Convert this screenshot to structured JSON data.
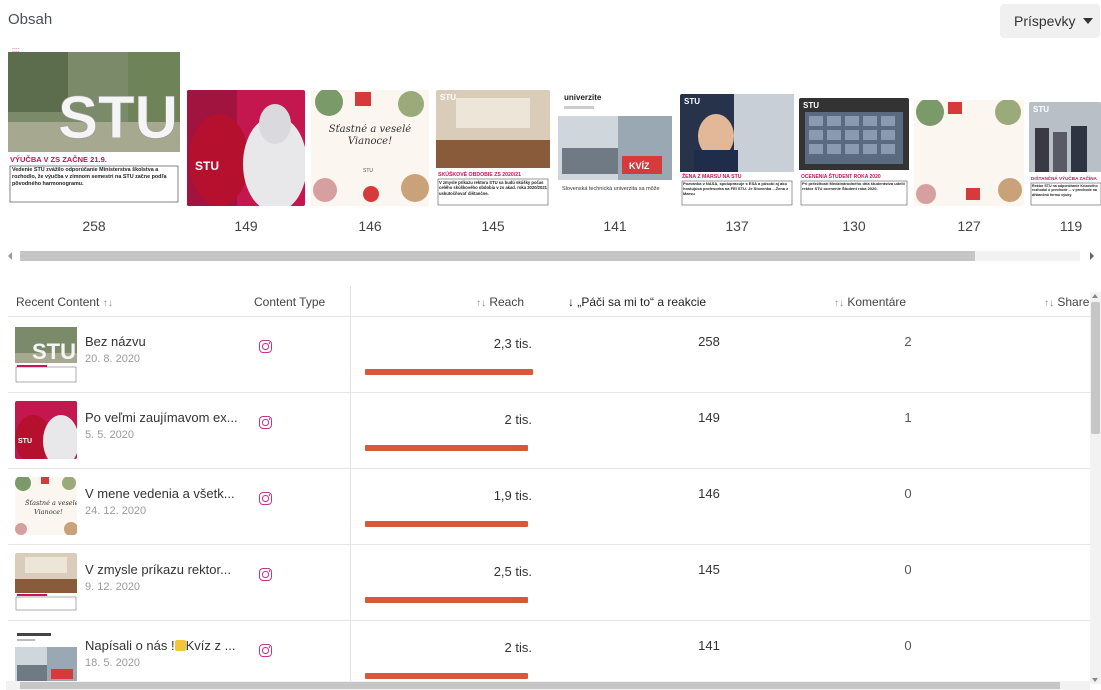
{
  "header": {
    "title": "Obsah",
    "dropdown_label": "Príspevky"
  },
  "colors": {
    "accent_bar": "#d8593a",
    "instagram": "#c0368e"
  },
  "strip": {
    "items": [
      {
        "value": "258",
        "caption": "VÝUČBA V ZS ZAČNE 21.9.",
        "logo": "STU",
        "text": "Vedenie STU zvážilo odporúčanie Ministerstva školstva a rozhodlo, že výučba v zimnom semestri na STU začne podľa pôvodného harmonogramu."
      },
      {
        "value": "149",
        "logo": "STU"
      },
      {
        "value": "146",
        "script": "Šťastné a veselé Vianoce!",
        "logo": "STU"
      },
      {
        "value": "145",
        "caption": "SKÚŠKOVÉ OBDOBIE ZS 2020/21",
        "logo": "STU",
        "text": "V zmysle príkazu rektora STU sa budú skúšky počas celého skúškového obdobia v zs akad. roka 2020/2021 uskutočňovať dištančne."
      },
      {
        "value": "141",
        "head": "univerzite",
        "badge": "KVÍZ",
        "text": "Slovenská technická univerzita sa môže"
      },
      {
        "value": "137",
        "caption": "ŽENA Z MARSU NA STU",
        "logo": "STU",
        "text": "Pozvanka v NASA, spolupracuje s ESA a pôsobí aj ako hostujúca profesorka na FEI STU. Je Slovenka ...Žena z Marsu"
      },
      {
        "value": "130",
        "caption": "OCENENIA ŠTUDENT ROKA 2020",
        "logo": "STU",
        "text": "Pri príležitosti Medzinárodného dňa študentstva udelil rektor STU ocenenie Študent roka 2020."
      },
      {
        "value": "127"
      },
      {
        "value": "119",
        "caption": "DIŠTANČNÁ VÝUČBA ZAČÍNA",
        "logo": "STU",
        "text": "Rektor STU na odporúčanie Krízového rozhodol o prechode ... v prechode na dištančnú formu výuky."
      }
    ]
  },
  "table": {
    "columns": {
      "recent_content": "Recent Content",
      "content_type": "Content Type",
      "reach": "Reach",
      "likes": "„Páči sa mi to“ a reakcie",
      "comments": "Komentáre",
      "shares": "Share"
    },
    "sort_glyph": "↑↓",
    "active_sort_glyph": "↓",
    "rows": [
      {
        "title": "Bez názvu",
        "date": "20. 8. 2020",
        "reach": "2,3 tis.",
        "reach_fraction": 1.0,
        "likes": "258",
        "comments": "2"
      },
      {
        "title": "Po veľmi zaujímavom ex...",
        "date": "5. 5. 2020",
        "reach": "2 tis.",
        "reach_fraction": 0.97,
        "likes": "149",
        "comments": "1"
      },
      {
        "title": "V mene vedenia a všetk...",
        "date": "24. 12. 2020",
        "reach": "1,9 tis.",
        "reach_fraction": 0.97,
        "likes": "146",
        "comments": "0"
      },
      {
        "title": "V zmysle príkazu rektor...",
        "date": "9. 12. 2020",
        "reach": "2,5 tis.",
        "reach_fraction": 0.97,
        "likes": "145",
        "comments": "0"
      },
      {
        "title_pre": "Napísali o nás !",
        "title_post": "Kvíz z ...",
        "date": "18. 5. 2020",
        "reach": "2 tis.",
        "reach_fraction": 0.97,
        "likes": "141",
        "comments": "0"
      }
    ]
  }
}
